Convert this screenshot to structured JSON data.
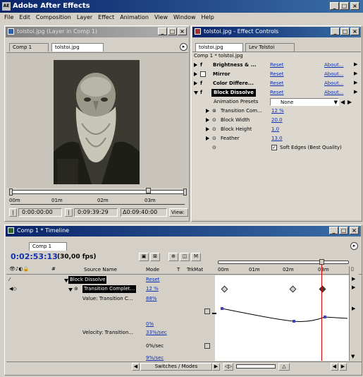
{
  "app": {
    "title": "Adobe After Effects",
    "title_icon": "AE"
  },
  "menu": [
    "File",
    "Edit",
    "Composition",
    "Layer",
    "Effect",
    "Animation",
    "View",
    "Window",
    "Help"
  ],
  "layer_window": {
    "title": "tolstoi.jpg (Layer in Comp 1)",
    "tabs": [
      "Comp 1",
      "tolstoi.jpg"
    ],
    "ruler_labels": [
      "00m",
      "01m",
      "02m",
      "03m"
    ],
    "time_start": "0:00:00:00",
    "time_end": "0:09:39:29",
    "time_duration": "Δ0:09:40:00",
    "view_label": "View:"
  },
  "effect_window": {
    "title": "tolstoi.jpg - Effect Controls",
    "tabs": [
      "tolstoi.jpg",
      "Lev Tolstoi"
    ],
    "breadcrumb": "Comp 1 * tolstoi.jpg",
    "effects": [
      {
        "name": "Brightness & ...",
        "reset": "Reset",
        "about": "About..."
      },
      {
        "name": "Mirror",
        "reset": "Reset",
        "about": "About..."
      },
      {
        "name": "Color Differe...",
        "reset": "Reset",
        "about": "About..."
      },
      {
        "name": "Block Dissolve",
        "reset": "Reset",
        "about": "About..."
      }
    ],
    "preset_label": "Animation Presets",
    "preset_value": "None",
    "params": [
      {
        "name": "Transition Com...",
        "value": "12 %"
      },
      {
        "name": "Block Width",
        "value": "20.0"
      },
      {
        "name": "Block Height",
        "value": "1.0"
      },
      {
        "name": "Feather",
        "value": "13.0"
      }
    ],
    "soft_edges": "Soft Edges (Best Quality)"
  },
  "timeline": {
    "title": "Comp 1 * Timeline",
    "tab": "Comp 1",
    "timecode": "0:02:53:13",
    "fps": "(30,00 fps)",
    "col_source": "Source Name",
    "col_mode": "Mode",
    "col_t": "T",
    "col_trkmat": "TrkMat",
    "ruler": [
      "00m",
      "01m",
      "02m",
      "03m"
    ],
    "layer_effect": "Block Dissolve",
    "layer_effect_reset": "Reset",
    "prop_name": "Transition Complet...",
    "prop_value": "12 %",
    "value_label": "Value: Transition C...",
    "value_val": "88%",
    "graph_zero": "0%",
    "velocity_label": "Velocity: Transition...",
    "velocity_val": "33%/sec",
    "vel_zero": "0%/sec",
    "vel_bottom": "9%/sec",
    "footer": "Switches / Modes"
  }
}
